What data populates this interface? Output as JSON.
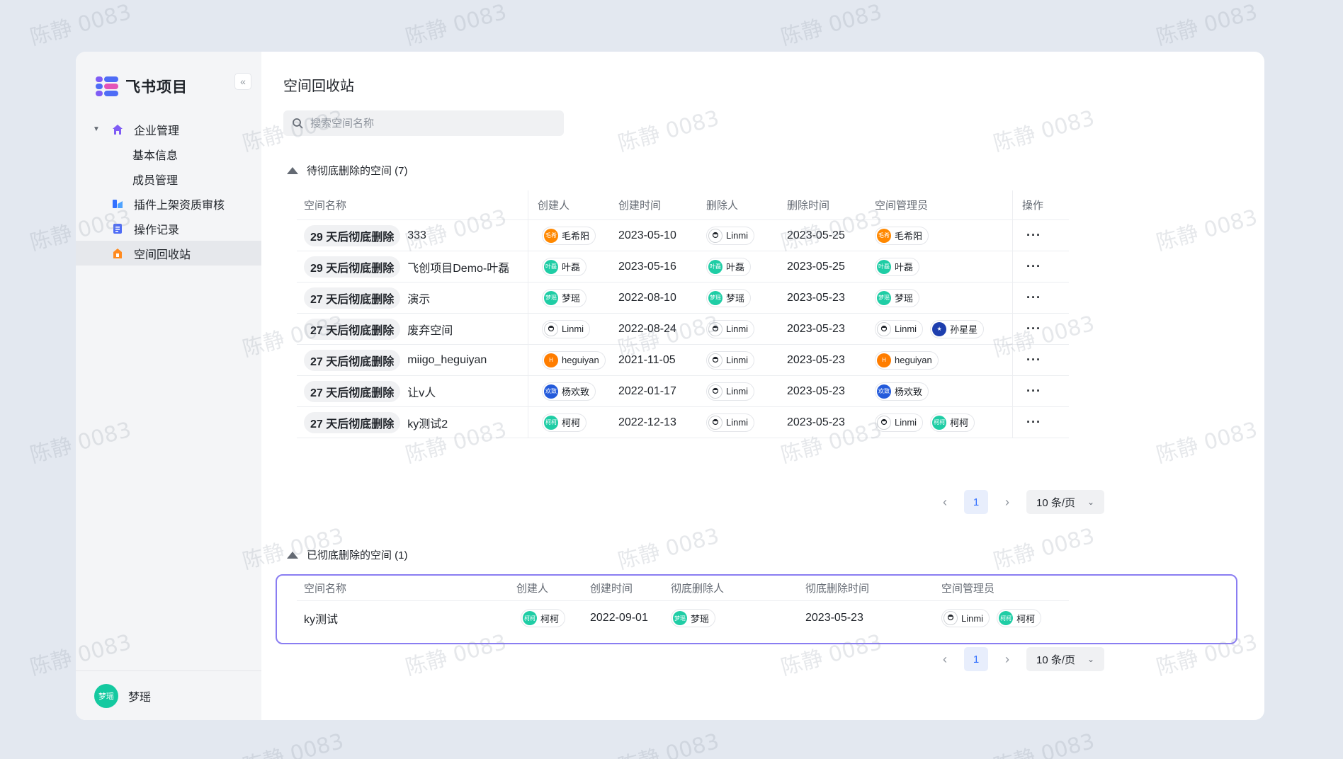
{
  "app": {
    "name": "飞书项目"
  },
  "watermark": "陈静 0083",
  "sidebar": {
    "collapse_label": "«",
    "items": [
      {
        "label": "企业管理",
        "icon": "home-icon"
      },
      {
        "label": "基本信息"
      },
      {
        "label": "成员管理"
      },
      {
        "label": "插件上架资质审核",
        "icon": "plugin-review-icon"
      },
      {
        "label": "操作记录",
        "icon": "log-icon"
      },
      {
        "label": "空间回收站",
        "icon": "recycle-bin-icon"
      }
    ],
    "user": {
      "avatar_text": "梦瑶",
      "name": "梦瑶"
    }
  },
  "main": {
    "title": "空间回收站",
    "search_placeholder": "搜索空间名称"
  },
  "pending": {
    "heading": "待彻底删除的空间 (7)",
    "columns": [
      "空间名称",
      "创建人",
      "创建时间",
      "删除人",
      "删除时间",
      "空间管理员",
      "操作"
    ],
    "rows": [
      {
        "badge": "29 天后彻底删除",
        "name": "333",
        "creator": {
          "n": "毛希阳",
          "a": "毛希",
          "c": "orange"
        },
        "created": "2023-05-10",
        "deleter": {
          "n": "Linmi",
          "a": "",
          "c": "face"
        },
        "deleted": "2023-05-25",
        "admins": [
          {
            "n": "毛希阳",
            "a": "毛希",
            "c": "orange"
          }
        ],
        "more": "···"
      },
      {
        "badge": "29 天后彻底删除",
        "name": "飞创项目Demo-叶磊",
        "creator": {
          "n": "叶磊",
          "a": "叶磊",
          "c": "teal"
        },
        "created": "2023-05-16",
        "deleter": {
          "n": "叶磊",
          "a": "叶磊",
          "c": "teal"
        },
        "deleted": "2023-05-25",
        "admins": [
          {
            "n": "叶磊",
            "a": "叶磊",
            "c": "teal"
          }
        ],
        "more": "···"
      },
      {
        "badge": "27 天后彻底删除",
        "name": "演示",
        "creator": {
          "n": "梦瑶",
          "a": "梦瑶",
          "c": "teal"
        },
        "created": "2022-08-10",
        "deleter": {
          "n": "梦瑶",
          "a": "梦瑶",
          "c": "teal"
        },
        "deleted": "2023-05-23",
        "admins": [
          {
            "n": "梦瑶",
            "a": "梦瑶",
            "c": "teal"
          }
        ],
        "more": "···"
      },
      {
        "badge": "27 天后彻底删除",
        "name": "废弃空间",
        "creator": {
          "n": "Linmi",
          "a": "",
          "c": "face"
        },
        "created": "2022-08-24",
        "deleter": {
          "n": "Linmi",
          "a": "",
          "c": "face"
        },
        "deleted": "2023-05-23",
        "admins": [
          {
            "n": "Linmi",
            "a": "",
            "c": "face"
          },
          {
            "n": "孙星星",
            "a": "★",
            "c": "navy"
          }
        ],
        "more": "···"
      },
      {
        "badge": "27 天后彻底删除",
        "name": "miigo_heguiyan",
        "creator": {
          "n": "heguiyan",
          "a": "H",
          "c": "orange2"
        },
        "created": "2021-11-05",
        "deleter": {
          "n": "Linmi",
          "a": "",
          "c": "face"
        },
        "deleted": "2023-05-23",
        "admins": [
          {
            "n": "heguiyan",
            "a": "H",
            "c": "orange2"
          }
        ],
        "more": "···"
      },
      {
        "badge": "27 天后彻底删除",
        "name": "让v人",
        "creator": {
          "n": "杨欢致",
          "a": "欢致",
          "c": "blue"
        },
        "created": "2022-01-17",
        "deleter": {
          "n": "Linmi",
          "a": "",
          "c": "face"
        },
        "deleted": "2023-05-23",
        "admins": [
          {
            "n": "杨欢致",
            "a": "欢致",
            "c": "blue"
          }
        ],
        "more": "···"
      },
      {
        "badge": "27 天后彻底删除",
        "name": "ky测试2",
        "creator": {
          "n": "柯柯",
          "a": "柯柯",
          "c": "teal"
        },
        "created": "2022-12-13",
        "deleter": {
          "n": "Linmi",
          "a": "",
          "c": "face"
        },
        "deleted": "2023-05-23",
        "admins": [
          {
            "n": "Linmi",
            "a": "",
            "c": "face"
          },
          {
            "n": "柯柯",
            "a": "柯柯",
            "c": "teal"
          }
        ],
        "more": "···"
      }
    ],
    "pager": {
      "page": "1",
      "size": "10 条/页"
    }
  },
  "deleted": {
    "heading": "已彻底删除的空间 (1)",
    "columns": [
      "空间名称",
      "创建人",
      "创建时间",
      "彻底删除人",
      "彻底删除时间",
      "空间管理员"
    ],
    "rows": [
      {
        "name": "ky测试",
        "creator": {
          "n": "柯柯",
          "a": "柯柯",
          "c": "teal"
        },
        "created": "2022-09-01",
        "deleter": {
          "n": "梦瑶",
          "a": "梦瑶",
          "c": "teal"
        },
        "deleted": "2023-05-23",
        "admins": [
          {
            "n": "Linmi",
            "a": "",
            "c": "face"
          },
          {
            "n": "柯柯",
            "a": "柯柯",
            "c": "teal"
          }
        ]
      }
    ],
    "pager": {
      "page": "1",
      "size": "10 条/页"
    }
  },
  "colors": {
    "accent": "#3370ff",
    "highlight": "#8a7df2",
    "sidebar_bg": "#f4f5f7"
  }
}
